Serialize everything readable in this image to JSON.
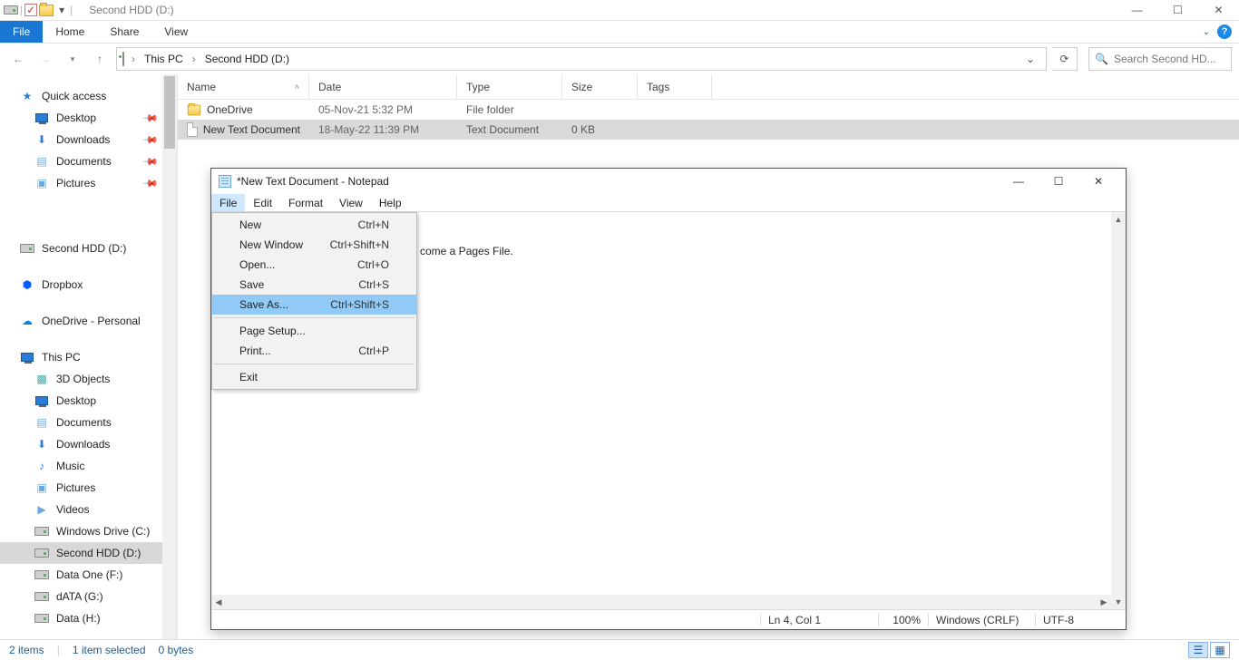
{
  "titlebar": {
    "title": "Second HDD (D:)"
  },
  "ribbon": {
    "file": "File",
    "home": "Home",
    "share": "Share",
    "view": "View"
  },
  "address": {
    "seg1": "This PC",
    "seg2": "Second HDD (D:)"
  },
  "search": {
    "placeholder": "Search Second HD..."
  },
  "nav": {
    "quick_access": "Quick access",
    "desktop": "Desktop",
    "downloads": "Downloads",
    "documents": "Documents",
    "pictures": "Pictures",
    "second_hdd": "Second HDD (D:)",
    "dropbox": "Dropbox",
    "onedrive": "OneDrive - Personal",
    "this_pc": "This PC",
    "objects3d": "3D Objects",
    "desktop2": "Desktop",
    "documents2": "Documents",
    "downloads2": "Downloads",
    "music": "Music",
    "pictures2": "Pictures",
    "videos": "Videos",
    "windows_drive": "Windows Drive (C:)",
    "second_hdd2": "Second HDD (D:)",
    "data_one": "Data One (F:)",
    "data_g": "dATA (G:)",
    "data_h": "Data (H:)"
  },
  "columns": {
    "name": "Name",
    "date": "Date",
    "type": "Type",
    "size": "Size",
    "tags": "Tags"
  },
  "files": [
    {
      "name": "OneDrive",
      "date": "05-Nov-21 5:32 PM",
      "type": "File folder",
      "size": ""
    },
    {
      "name": "New Text Document",
      "date": "18-May-22 11:39 PM",
      "type": "Text Document",
      "size": "0 KB"
    }
  ],
  "status": {
    "items": "2 items",
    "selected": "1 item selected",
    "bytes": "0 bytes"
  },
  "notepad": {
    "title": "*New Text Document - Notepad",
    "menu": {
      "file": "File",
      "edit": "Edit",
      "format": "Format",
      "view": "View",
      "help": "Help"
    },
    "content_visible": "come a Pages File.",
    "dropdown": [
      {
        "label": "New",
        "shortcut": "Ctrl+N"
      },
      {
        "label": "New Window",
        "shortcut": "Ctrl+Shift+N"
      },
      {
        "label": "Open...",
        "shortcut": "Ctrl+O"
      },
      {
        "label": "Save",
        "shortcut": "Ctrl+S"
      },
      {
        "label": "Save As...",
        "shortcut": "Ctrl+Shift+S"
      },
      {
        "label": "Page Setup...",
        "shortcut": ""
      },
      {
        "label": "Print...",
        "shortcut": "Ctrl+P"
      },
      {
        "label": "Exit",
        "shortcut": ""
      }
    ],
    "status": {
      "pos": "Ln 4, Col 1",
      "zoom": "100%",
      "eol": "Windows (CRLF)",
      "enc": "UTF-8"
    }
  }
}
